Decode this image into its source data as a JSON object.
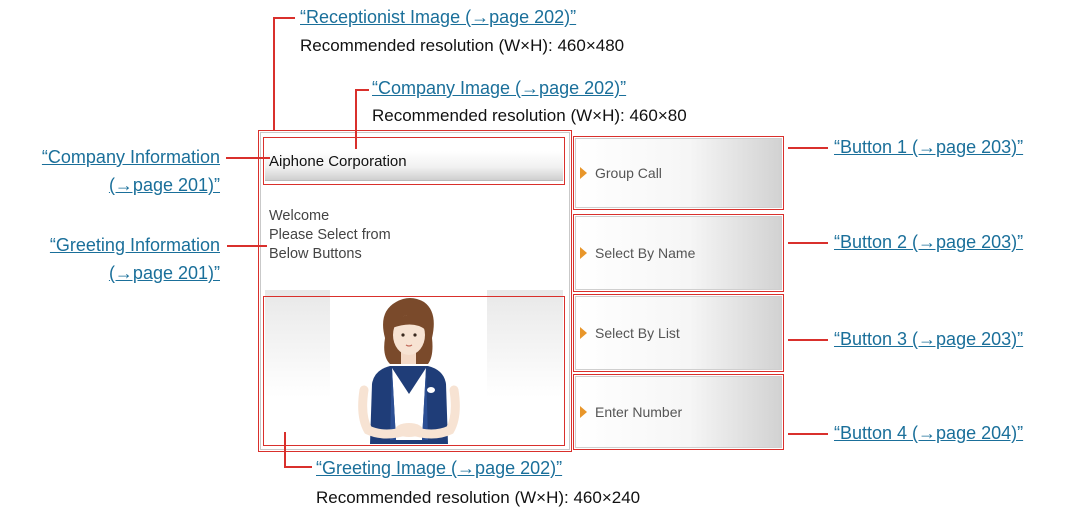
{
  "callouts": {
    "receptionist_image": {
      "link": "“Receptionist Image (→page 202)”",
      "note": "Recommended resolution (W×H): 460×480"
    },
    "company_image": {
      "link": "“Company Image (→page 202)”",
      "note": "Recommended resolution (W×H): 460×80"
    },
    "greeting_image": {
      "link": "“Greeting Image (→page 202)”",
      "note": "Recommended resolution (W×H): 460×240"
    },
    "company_information": {
      "line1": "“Company Information",
      "line2": "(→page 201)”"
    },
    "greeting_information": {
      "line1": "“Greeting Information",
      "line2": "(→page 201)”"
    },
    "button1": "“Button 1 (→page 203)”",
    "button2": "“Button 2 (→page 203)”",
    "button3": "“Button 3 (→page 203)”",
    "button4": "“Button 4 (→page 204)”"
  },
  "screen": {
    "company_name": "Aiphone Corporation",
    "greeting_text": "Welcome\nPlease Select from\nBelow Buttons",
    "buttons": [
      {
        "label": "Group Call"
      },
      {
        "label": "Select By Name"
      },
      {
        "label": "Select By List"
      },
      {
        "label": "Enter Number"
      }
    ]
  },
  "colors": {
    "link": "#1a6f9a",
    "callout_line": "#d9302c",
    "button_arrow": "#e8962a"
  }
}
